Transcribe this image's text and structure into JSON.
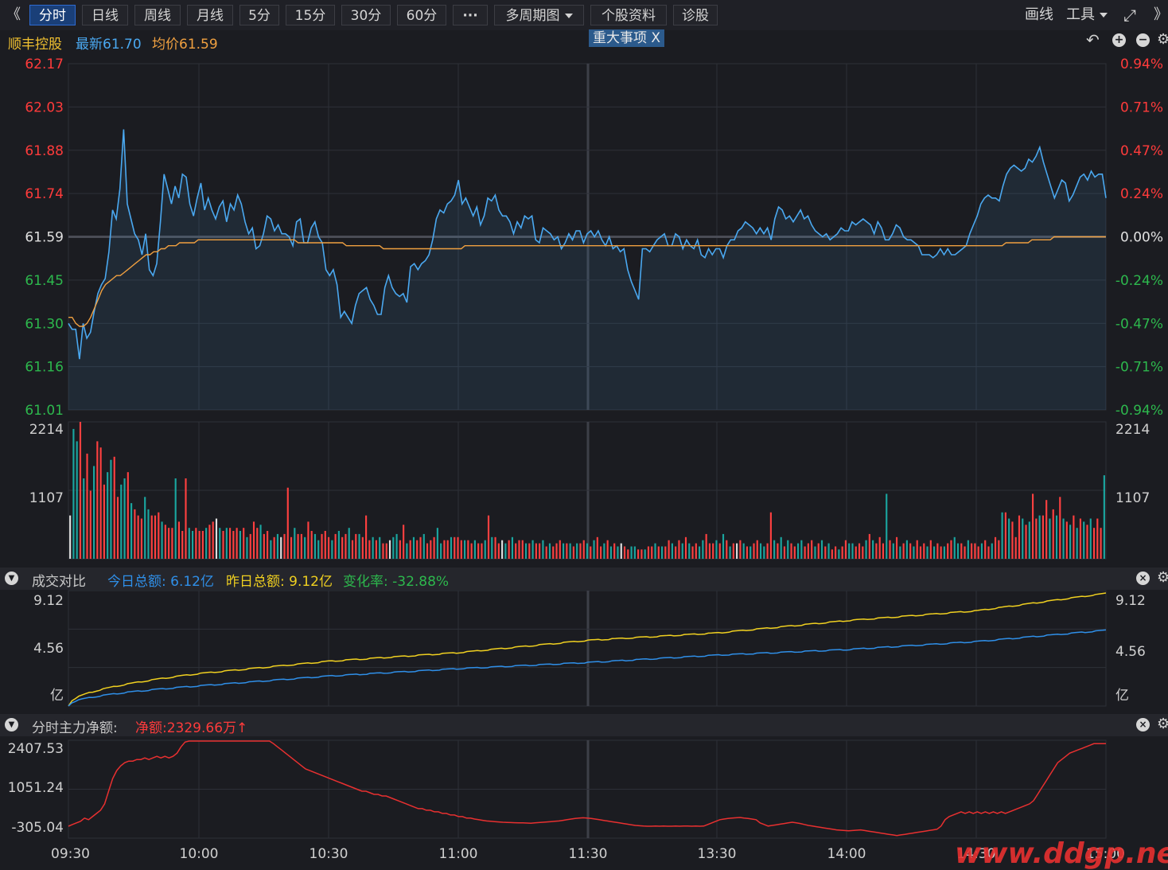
{
  "toolbar": {
    "collapse_left": "《",
    "tabs": [
      {
        "label": "分时",
        "active": true
      },
      {
        "label": "日线"
      },
      {
        "label": "周线"
      },
      {
        "label": "月线"
      },
      {
        "label": "5分"
      },
      {
        "label": "15分"
      },
      {
        "label": "30分"
      },
      {
        "label": "60分"
      },
      {
        "label": "···"
      },
      {
        "label": "多周期图"
      },
      {
        "label": "个股资料"
      },
      {
        "label": "诊股"
      }
    ],
    "draw_label": "画线",
    "tools_label": "工具",
    "collapse_right": "》"
  },
  "info": {
    "stock_name": "顺丰控股",
    "latest_label": "最新61.70",
    "avg_label": "均价61.59",
    "event_tag": "重大事项",
    "event_close": "X"
  },
  "colors": {
    "up": "#ff3b3b",
    "down": "#2db84d",
    "price_line": "#4aa8f0",
    "avg_line": "#f0a040",
    "today_line": "#2f8fe8",
    "yesterday_line": "#f0d020",
    "netflow_line": "#e83030",
    "volume_teal": "#1aa6a0",
    "volume_red": "#ff4040",
    "volume_white": "#e0e0e0"
  },
  "chart_data": [
    {
      "type": "line",
      "name_id": "intraday-price",
      "prev_close": 61.59,
      "ylim": [
        61.01,
        62.17
      ],
      "left_ticks": [
        "62.17",
        "62.03",
        "61.88",
        "61.74",
        "61.59",
        "61.45",
        "61.30",
        "61.16",
        "61.01"
      ],
      "right_ticks": [
        "0.94%",
        "0.71%",
        "0.47%",
        "0.24%",
        "0.00%",
        "-0.24%",
        "-0.47%",
        "-0.71%",
        "-0.94%"
      ],
      "price_series": [
        61.3,
        61.28,
        61.28,
        61.18,
        61.3,
        61.25,
        61.27,
        61.34,
        61.4,
        61.43,
        61.45,
        61.54,
        61.68,
        61.65,
        61.75,
        61.95,
        61.7,
        61.65,
        61.6,
        61.58,
        61.53,
        61.6,
        61.48,
        61.46,
        61.5,
        61.64,
        61.8,
        61.75,
        61.7,
        61.76,
        61.72,
        61.8,
        61.79,
        61.7,
        61.66,
        61.72,
        61.77,
        61.68,
        61.72,
        61.68,
        61.65,
        61.69,
        61.71,
        61.64,
        61.7,
        61.68,
        61.73,
        61.7,
        61.64,
        61.6,
        61.62,
        61.55,
        61.56,
        61.6,
        61.66,
        61.65,
        61.61,
        61.63,
        61.6,
        61.6,
        61.59,
        61.56,
        61.64,
        61.65,
        61.57,
        61.57,
        61.62,
        61.64,
        61.59,
        61.57,
        61.48,
        61.46,
        61.48,
        61.43,
        61.32,
        61.34,
        61.32,
        61.3,
        61.36,
        61.4,
        61.41,
        61.42,
        61.38,
        61.36,
        61.33,
        61.33,
        61.42,
        61.46,
        61.42,
        61.4,
        61.39,
        61.4,
        61.37,
        61.49,
        61.5,
        61.48,
        61.5,
        61.51,
        61.53,
        61.58,
        61.65,
        61.68,
        61.67,
        61.7,
        61.71,
        61.73,
        61.78,
        61.7,
        61.72,
        61.69,
        61.66,
        61.69,
        61.63,
        61.66,
        61.72,
        61.71,
        61.73,
        61.68,
        61.66,
        61.66,
        61.64,
        61.6,
        61.64,
        61.62,
        61.66,
        61.65,
        61.66,
        61.58,
        61.57,
        61.62,
        61.61,
        61.6,
        61.58,
        61.59,
        61.55,
        61.57,
        61.6,
        61.58,
        61.61,
        61.61,
        61.57,
        61.6,
        61.61,
        61.59,
        61.61,
        61.58,
        61.56,
        61.59,
        61.55,
        61.56,
        61.54,
        61.55,
        61.48,
        61.44,
        61.41,
        61.38,
        61.55,
        61.55,
        61.54,
        61.56,
        61.58,
        61.59,
        61.6,
        61.56,
        61.56,
        61.6,
        61.59,
        61.55,
        61.58,
        61.56,
        61.55,
        61.58,
        61.53,
        61.52,
        61.55,
        61.53,
        61.55,
        61.55,
        61.52,
        61.56,
        61.58,
        61.58,
        61.61,
        61.62,
        61.64,
        61.63,
        61.62,
        61.6,
        61.62,
        61.6,
        61.62,
        61.58,
        61.65,
        61.69,
        61.68,
        61.65,
        61.66,
        61.64,
        61.66,
        61.68,
        61.65,
        61.66,
        61.63,
        61.61,
        61.6,
        61.59,
        61.6,
        61.58,
        61.59,
        61.6,
        61.62,
        61.61,
        61.61,
        61.64,
        61.63,
        61.64,
        61.65,
        61.64,
        61.63,
        61.6,
        61.64,
        61.62,
        61.58,
        61.58,
        61.6,
        61.63,
        61.62,
        61.59,
        61.58,
        61.58,
        61.57,
        61.56,
        61.53,
        61.53,
        61.53,
        61.52,
        61.53,
        61.55,
        61.53,
        61.55,
        61.53,
        61.53,
        61.54,
        61.55,
        61.56,
        61.6,
        61.63,
        61.66,
        61.7,
        61.72,
        61.73,
        61.72,
        61.72,
        61.71,
        61.76,
        61.8,
        61.82,
        61.83,
        61.82,
        61.81,
        61.82,
        61.85,
        61.84,
        61.86,
        61.89,
        61.84,
        61.8,
        61.76,
        61.72,
        61.75,
        61.78,
        61.77,
        61.71,
        61.73,
        61.76,
        61.79,
        61.8,
        61.78,
        61.81,
        61.79,
        61.8,
        61.8,
        61.72
      ],
      "avg_series": [
        61.32,
        61.32,
        61.3,
        61.29,
        61.29,
        61.3,
        61.32,
        61.35,
        61.38,
        61.41,
        61.43,
        61.44,
        61.45,
        61.46,
        61.46,
        61.47,
        61.48,
        61.49,
        61.5,
        61.51,
        61.52,
        61.53,
        61.53,
        61.54,
        61.54,
        61.55,
        61.55,
        61.56,
        61.56,
        61.56,
        61.57,
        61.57,
        61.57,
        61.57,
        61.57,
        61.58,
        61.58,
        61.58,
        61.58,
        61.58,
        61.58,
        61.58,
        61.58,
        61.58,
        61.58,
        61.58,
        61.58,
        61.58,
        61.58,
        61.58,
        61.58,
        61.58,
        61.58,
        61.58,
        61.58,
        61.58,
        61.58,
        61.58,
        61.58,
        61.58,
        61.58,
        61.58,
        61.57,
        61.57,
        61.57,
        61.57,
        61.57,
        61.57,
        61.57,
        61.57,
        61.57,
        61.57,
        61.57,
        61.57,
        61.57,
        61.56,
        61.56,
        61.56,
        61.56,
        61.56,
        61.56,
        61.56,
        61.56,
        61.56,
        61.56,
        61.55,
        61.55,
        61.55,
        61.55,
        61.55,
        61.55,
        61.55,
        61.55,
        61.55,
        61.55,
        61.55,
        61.55,
        61.55,
        61.55,
        61.55,
        61.55,
        61.55,
        61.55,
        61.55,
        61.55,
        61.55,
        61.55,
        61.56,
        61.56,
        61.56,
        61.56,
        61.56,
        61.56,
        61.56,
        61.56,
        61.56,
        61.56,
        61.56,
        61.56,
        61.56,
        61.56,
        61.56,
        61.56,
        61.56,
        61.56,
        61.56,
        61.56,
        61.56,
        61.56,
        61.56,
        61.56,
        61.56,
        61.56,
        61.56,
        61.56,
        61.56,
        61.56,
        61.56,
        61.56,
        61.56,
        61.56,
        61.56,
        61.56,
        61.56,
        61.56,
        61.56,
        61.56,
        61.56,
        61.56,
        61.56,
        61.56,
        61.56,
        61.56,
        61.56,
        61.56,
        61.56,
        61.56,
        61.56,
        61.56,
        61.56,
        61.56,
        61.56,
        61.56,
        61.56,
        61.56,
        61.56,
        61.56,
        61.56,
        61.56,
        61.56,
        61.56,
        61.56,
        61.56,
        61.56,
        61.56,
        61.56,
        61.56,
        61.56,
        61.56,
        61.56,
        61.56,
        61.56,
        61.56,
        61.56,
        61.56,
        61.56,
        61.56,
        61.56,
        61.56,
        61.56,
        61.56,
        61.56,
        61.56,
        61.56,
        61.56,
        61.56,
        61.56,
        61.56,
        61.56,
        61.56,
        61.56,
        61.56,
        61.56,
        61.56,
        61.56,
        61.56,
        61.56,
        61.56,
        61.56,
        61.56,
        61.56,
        61.56,
        61.56,
        61.56,
        61.56,
        61.56,
        61.56,
        61.56,
        61.56,
        61.56,
        61.56,
        61.56,
        61.56,
        61.56,
        61.56,
        61.56,
        61.56,
        61.56,
        61.56,
        61.56,
        61.56,
        61.56,
        61.56,
        61.56,
        61.56,
        61.56,
        61.56,
        61.56,
        61.56,
        61.56,
        61.56,
        61.56,
        61.56,
        61.56,
        61.56,
        61.56,
        61.56,
        61.56,
        61.56,
        61.56,
        61.56,
        61.56,
        61.56,
        61.57,
        61.57,
        61.57,
        61.57,
        61.57,
        61.57,
        61.57,
        61.58,
        61.58,
        61.58,
        61.58,
        61.58,
        61.58,
        61.59,
        61.59,
        61.59,
        61.59,
        61.59,
        61.59,
        61.59,
        61.59,
        61.59,
        61.59,
        61.59,
        61.59,
        61.59,
        61.59,
        61.59
      ]
    },
    {
      "type": "bar",
      "name_id": "volume",
      "ylim": [
        0,
        2214
      ],
      "left_ticks": [
        "2214",
        "1107"
      ],
      "right_ticks": [
        "2214",
        "1107"
      ],
      "values": [
        700,
        2100,
        1900,
        2214,
        1300,
        1700,
        1100,
        1500,
        1900,
        1800,
        1200,
        1400,
        1600,
        1650,
        1000,
        1200,
        1300,
        1400,
        900,
        800,
        700,
        650,
        1000,
        800,
        700,
        700,
        750,
        600,
        550,
        500,
        500,
        1300,
        600,
        450,
        1300,
        500,
        450,
        500,
        450,
        450,
        500,
        550,
        600,
        650,
        500,
        450,
        500,
        500,
        450,
        500,
        450,
        500,
        350,
        400,
        600,
        500,
        550,
        400,
        450,
        300,
        350,
        400,
        350,
        400,
        1150,
        350,
        500,
        400,
        400,
        350,
        600,
        450,
        400,
        300,
        400,
        450,
        350,
        300,
        400,
        450,
        350,
        400,
        500,
        300,
        400,
        400,
        350,
        700,
        300,
        350,
        300,
        350,
        250,
        250,
        300,
        350,
        400,
        300,
        550,
        250,
        300,
        350,
        300,
        350,
        400,
        250,
        300,
        350,
        500,
        250,
        300,
        300,
        350,
        350,
        350,
        300,
        300,
        300,
        250,
        300,
        250,
        250,
        300,
        700,
        350,
        350,
        250,
        300,
        250,
        300,
        350,
        250,
        300,
        300,
        250,
        250,
        300,
        250,
        250,
        300,
        200,
        250,
        200,
        250,
        300,
        250,
        250,
        250,
        200,
        250,
        250,
        300,
        250,
        200,
        300,
        350,
        200,
        250,
        300,
        200,
        250,
        200,
        250,
        200,
        150,
        200,
        200,
        150,
        150,
        150,
        200,
        200,
        250,
        200,
        200,
        200,
        300,
        250,
        200,
        300,
        250,
        350,
        250,
        200,
        250,
        200,
        300,
        400,
        250,
        250,
        300,
        250,
        400,
        300,
        200,
        250,
        250,
        300,
        250,
        200,
        200,
        250,
        300,
        250,
        200,
        250,
        750,
        300,
        250,
        350,
        200,
        300,
        250,
        200,
        250,
        300,
        200,
        250,
        300,
        200,
        250,
        300,
        200,
        250,
        150,
        200,
        150,
        200,
        300,
        250,
        250,
        200,
        250,
        200,
        300,
        400,
        300,
        250,
        350,
        250,
        1050,
        300,
        250,
        350,
        200,
        250,
        300,
        250,
        200,
        300,
        200,
        250,
        200,
        300,
        200,
        250,
        200,
        200,
        250,
        300,
        350,
        250,
        250,
        200,
        300,
        250,
        250,
        200,
        250,
        300,
        200,
        250,
        350,
        300,
        750,
        750,
        650,
        600,
        350,
        700,
        650,
        550,
        600,
        1050,
        650,
        700,
        700,
        950,
        650,
        800,
        700,
        1000,
        650,
        600,
        550,
        700,
        500,
        650,
        600,
        550,
        650,
        500,
        650,
        500,
        1350
      ],
      "colors_code": "wttrtrrtrrrttrrttrtrrrttrrrtrrrtrrrttrrrtrrwtrtrrrtrtrrrtrrtrtwrrrtrrtrrttrrrtrtrrtrrtrrrtrtrrwttrrtrtrrtrrrttrrtrrrtrrtrrtrtrrwtrtrrrtrtrrtrtrrrtrtrtrrtrtrrtrtrtwrrttrrtrrtrtrrtrrtrtrrttrrrtrtrtrwrtrtrrttrrtrtrtrrttrrrtrtrtrrtrrttrrrtrtrrrtrtrtrtrtrrrtrtrrtrrttrrtrrrtrrtrrtrtrrrtrtrrtrrtrtrtrtrtrtrtrrrtrtt"
    },
    {
      "type": "line",
      "name_id": "turnover-compare",
      "ylim": [
        0,
        9.12
      ],
      "left_ticks": [
        "9.12",
        "4.56",
        "亿"
      ],
      "right_ticks": [
        "9.12",
        "4.56",
        "亿"
      ],
      "x": [
        "09:30",
        "10:00",
        "10:30",
        "11:00",
        "11:30",
        "13:30",
        "14:00",
        "14:30",
        "15:00"
      ],
      "today": [
        0.0,
        1.6,
        2.4,
        3.0,
        3.5,
        4.1,
        4.55,
        5.2,
        6.12
      ],
      "yesterday": [
        0.0,
        2.6,
        3.6,
        4.3,
        5.3,
        5.9,
        6.9,
        7.7,
        9.12
      ]
    },
    {
      "type": "line",
      "name_id": "main-net-flow",
      "ylim": [
        -305.04,
        2407.53
      ],
      "left_ticks": [
        "2407.53",
        "1051.24",
        "-305.04"
      ],
      "values": [
        -305,
        -250,
        -200,
        -150,
        -50,
        -100,
        0,
        100,
        200,
        400,
        800,
        1200,
        1450,
        1600,
        1700,
        1750,
        1750,
        1800,
        1800,
        1850,
        1800,
        1850,
        1900,
        1850,
        1900,
        1850,
        1900,
        2000,
        2200,
        2350,
        2400,
        2450,
        2500,
        2450,
        2500,
        2450,
        2500,
        2550,
        2500,
        2400,
        2450,
        2500,
        2450,
        2500,
        2550,
        2500,
        2450,
        2500,
        2550,
        2500,
        2400,
        2300,
        2200,
        2100,
        2000,
        1900,
        1800,
        1700,
        1600,
        1500,
        1450,
        1400,
        1350,
        1300,
        1250,
        1200,
        1150,
        1100,
        1050,
        1000,
        950,
        900,
        850,
        800,
        800,
        750,
        700,
        700,
        650,
        650,
        600,
        550,
        500,
        450,
        400,
        350,
        300,
        250,
        250,
        200,
        200,
        150,
        150,
        100,
        100,
        50,
        50,
        0,
        0,
        -50,
        -50,
        -80,
        -100,
        -120,
        -140,
        -150,
        -160,
        -170,
        -180,
        -185,
        -190,
        -195,
        -200,
        -200,
        -205,
        -210,
        -200,
        -190,
        -180,
        -170,
        -160,
        -150,
        -140,
        -120,
        -100,
        -80,
        -60,
        -50,
        -40,
        -50,
        -60,
        -80,
        -100,
        -120,
        -140,
        -160,
        -180,
        -200,
        -220,
        -240,
        -260,
        -280,
        -290,
        -300,
        -305,
        -305,
        -300,
        -305,
        -300,
        -305,
        -305,
        -300,
        -305,
        -300,
        -300,
        -305,
        -300,
        -305,
        -300,
        -250,
        -200,
        -150,
        -100,
        -80,
        -60,
        -50,
        -40,
        -30,
        -50,
        -60,
        -80,
        -100,
        -200,
        -250,
        -300,
        -280,
        -260,
        -240,
        -220,
        -200,
        -180,
        -200,
        -220,
        -250,
        -280,
        -300,
        -320,
        -340,
        -360,
        -380,
        -400,
        -420,
        -430,
        -440,
        -450,
        -440,
        -430,
        -420,
        -440,
        -460,
        -480,
        -500,
        -520,
        -540,
        -560,
        -580,
        -600,
        -580,
        -560,
        -540,
        -520,
        -500,
        -480,
        -460,
        -440,
        -420,
        -400,
        -300,
        -100,
        0,
        50,
        100,
        150,
        100,
        150,
        100,
        150,
        100,
        150,
        100,
        150,
        100,
        150,
        100,
        150,
        200,
        250,
        300,
        350,
        400,
        500,
        700,
        900,
        1100,
        1300,
        1500,
        1700,
        1800,
        1900,
        2000,
        2050,
        2100,
        2150,
        2200,
        2250,
        2300,
        2300,
        2300,
        2300
      ]
    }
  ],
  "x_axis_labels": [
    "09:30",
    "10:00",
    "10:30",
    "11:00",
    "11:30",
    "13:30",
    "14:00",
    "14:30",
    "15:00"
  ],
  "turnover_panel": {
    "title": "成交对比",
    "today_total": "今日总额: 6.12亿",
    "yesterday_total": "昨日总额: 9.12亿",
    "change_rate": "变化率: -32.88%"
  },
  "netflow_panel": {
    "title": "分时主力净额:",
    "net_amount": "净额:2329.66万",
    "arrow": "↑"
  },
  "watermark": "www.ddgp.net"
}
